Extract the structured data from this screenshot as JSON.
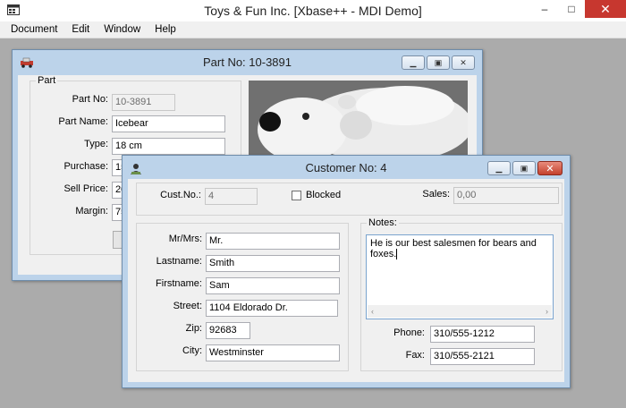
{
  "app": {
    "title": "Toys & Fun Inc. [Xbase++ - MDI Demo]",
    "icon": "app-window-icon",
    "controls": {
      "minimize": "–",
      "maximize": "□",
      "close": "✕"
    }
  },
  "menu": [
    "Document",
    "Edit",
    "Window",
    "Help"
  ],
  "part_window": {
    "title": "Part No: 10-3891",
    "group_label": "Part",
    "labels": {
      "part_no": "Part No:",
      "part_name": "Part Name:",
      "type": "Type:",
      "purchase": "Purchase:",
      "sell_price": "Sell Price:",
      "margin": "Margin:"
    },
    "values": {
      "part_no": "10-3891",
      "part_name": "Icebear",
      "type": "18 cm",
      "purchase": "15",
      "sell_price": "20",
      "margin": "75"
    }
  },
  "customer_window": {
    "title": "Customer No: 4",
    "labels": {
      "cust_no": "Cust.No.:",
      "blocked": "Blocked",
      "sales": "Sales:",
      "mrmrs": "Mr/Mrs:",
      "lastname": "Lastname:",
      "firstname": "Firstname:",
      "street": "Street:",
      "zip": "Zip:",
      "city": "City:",
      "notes": "Notes:",
      "phone": "Phone:",
      "fax": "Fax:"
    },
    "values": {
      "cust_no": "4",
      "blocked": false,
      "sales": "0,00",
      "mrmrs": "Mr.",
      "lastname": "Smith",
      "firstname": "Sam",
      "street": "1104 Eldorado Dr.",
      "zip": "92683",
      "city": "Westminster",
      "notes": "He is our best salesmen for bears and foxes.",
      "phone": "310/555-1212",
      "fax": "310/555-2121"
    }
  },
  "colors": {
    "mdi_background": "#ababab",
    "child_frame": "#bcd3ea",
    "close_button": "#c7372f"
  }
}
